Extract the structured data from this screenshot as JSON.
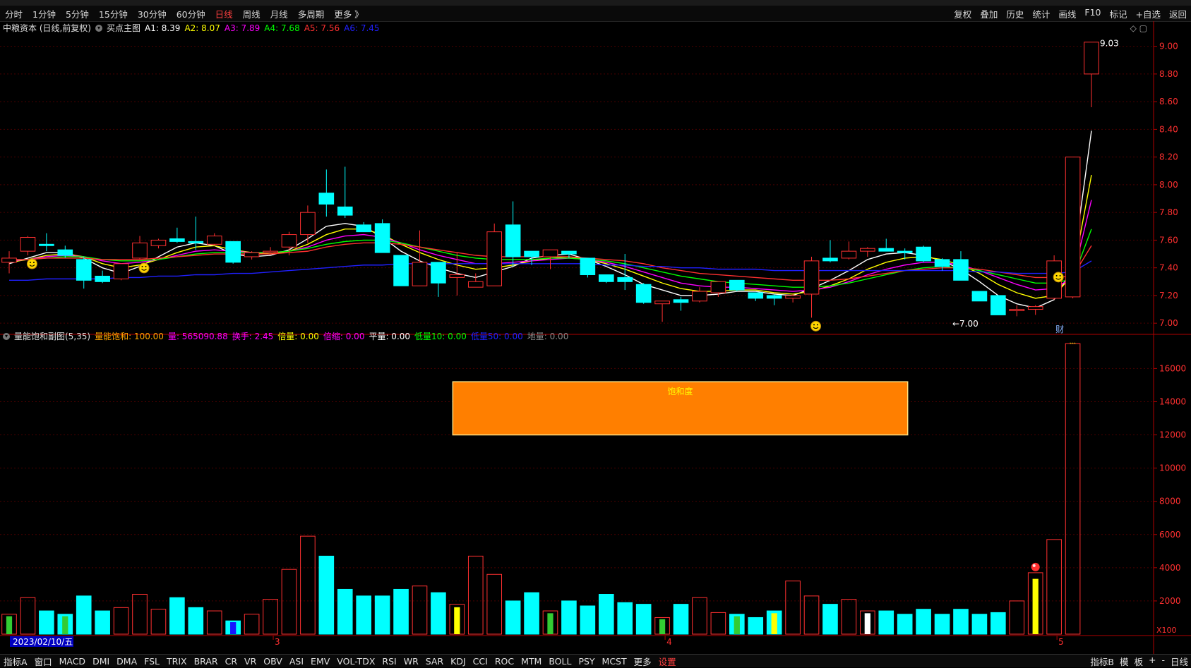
{
  "periods": [
    "分时",
    "1分钟",
    "5分钟",
    "15分钟",
    "30分钟",
    "60分钟",
    "日线",
    "周线",
    "月线",
    "多周期",
    "更多 》"
  ],
  "active_period": "日线",
  "toolbar_right": [
    "复权",
    "叠加",
    "历史",
    "统计",
    "画线",
    "F10",
    "标记",
    "+自选",
    "返回"
  ],
  "main_legend": {
    "title": "中粮资本 (日线,前复权)",
    "indicator": "买点主图",
    "items": [
      {
        "label": "A1: 8.39",
        "color": "#ffffff"
      },
      {
        "label": "A2: 8.07",
        "color": "#ffff00"
      },
      {
        "label": "A3: 7.89",
        "color": "#ff00ff"
      },
      {
        "label": "A4: 7.68",
        "color": "#00ff00"
      },
      {
        "label": "A5: 7.56",
        "color": "#ff3030"
      },
      {
        "label": "A6: 7.45",
        "color": "#2020ff"
      }
    ]
  },
  "sub_legend": {
    "title": "量能饱和副图(5,35)",
    "items": [
      {
        "label": "量能饱和: 100.00",
        "color": "#ffa500"
      },
      {
        "label": "量: 565090.88",
        "color": "#ff00ff"
      },
      {
        "label": "换手: 2.45",
        "color": "#ff00ff"
      },
      {
        "label": "倍量: 0.00",
        "color": "#ffff00"
      },
      {
        "label": "倍缩: 0.00",
        "color": "#ff00ff"
      },
      {
        "label": "平量: 0.00",
        "color": "#ffffff"
      },
      {
        "label": "低量10: 0.00",
        "color": "#00ff00"
      },
      {
        "label": "低量50: 0.00",
        "color": "#2020ff"
      },
      {
        "label": "地量: 0.00",
        "color": "#888888"
      }
    ]
  },
  "bottom_tabs": [
    "指标A",
    "窗口",
    "MACD",
    "DMI",
    "DMA",
    "FSL",
    "TRIX",
    "BRAR",
    "CR",
    "VR",
    "OBV",
    "ASI",
    "EMV",
    "VOL-TDX",
    "RSI",
    "WR",
    "SAR",
    "KDJ",
    "CCI",
    "ROC",
    "MTM",
    "BOLL",
    "PSY",
    "MCST",
    "更多",
    "设置"
  ],
  "bottom_right": [
    "指标B",
    "模",
    "板",
    "+",
    "-",
    "日线"
  ],
  "colors": {
    "up": "#ff3030",
    "down": "#00ffff",
    "axis": "#b00000",
    "bg": "#000000",
    "box": "#ff7f00"
  },
  "chart_data": [
    {
      "type": "candlestick",
      "ylim": [
        6.95,
        9.1
      ],
      "yticks": [
        "7.00",
        "7.20",
        "7.40",
        "7.60",
        "7.80",
        "8.00",
        "8.20",
        "8.40",
        "8.60",
        "8.80",
        "9.00"
      ],
      "annotations": {
        "high": "9.03",
        "low": "←7.00",
        "event": "财",
        "start_date": "2023/02/10/五",
        "month_marks": [
          "3",
          "4",
          "5"
        ]
      },
      "candles": [
        {
          "o": 7.44,
          "h": 7.52,
          "l": 7.36,
          "c": 7.47
        },
        {
          "o": 7.52,
          "h": 7.63,
          "l": 7.49,
          "c": 7.62
        },
        {
          "o": 7.57,
          "h": 7.65,
          "l": 7.52,
          "c": 7.56
        },
        {
          "o": 7.53,
          "h": 7.56,
          "l": 7.47,
          "c": 7.49
        },
        {
          "o": 7.46,
          "h": 7.48,
          "l": 7.25,
          "c": 7.31
        },
        {
          "o": 7.34,
          "h": 7.38,
          "l": 7.29,
          "c": 7.3
        },
        {
          "o": 7.32,
          "h": 7.43,
          "l": 7.31,
          "c": 7.43
        },
        {
          "o": 7.47,
          "h": 7.63,
          "l": 7.46,
          "c": 7.58
        },
        {
          "o": 7.56,
          "h": 7.61,
          "l": 7.54,
          "c": 7.6
        },
        {
          "o": 7.61,
          "h": 7.69,
          "l": 7.58,
          "c": 7.59
        },
        {
          "o": 7.59,
          "h": 7.77,
          "l": 7.53,
          "c": 7.58
        },
        {
          "o": 7.57,
          "h": 7.65,
          "l": 7.56,
          "c": 7.63
        },
        {
          "o": 7.59,
          "h": 7.59,
          "l": 7.43,
          "c": 7.44
        },
        {
          "o": 7.48,
          "h": 7.52,
          "l": 7.46,
          "c": 7.51
        },
        {
          "o": 7.51,
          "h": 7.55,
          "l": 7.5,
          "c": 7.52
        },
        {
          "o": 7.55,
          "h": 7.66,
          "l": 7.49,
          "c": 7.64
        },
        {
          "o": 7.64,
          "h": 7.85,
          "l": 7.58,
          "c": 7.8
        },
        {
          "o": 7.94,
          "h": 8.11,
          "l": 7.77,
          "c": 7.86
        },
        {
          "o": 7.84,
          "h": 8.13,
          "l": 7.76,
          "c": 7.78
        },
        {
          "o": 7.71,
          "h": 7.73,
          "l": 7.66,
          "c": 7.66
        },
        {
          "o": 7.72,
          "h": 7.75,
          "l": 7.51,
          "c": 7.51
        },
        {
          "o": 7.49,
          "h": 7.49,
          "l": 7.27,
          "c": 7.27
        },
        {
          "o": 7.27,
          "h": 7.67,
          "l": 7.27,
          "c": 7.44
        },
        {
          "o": 7.44,
          "h": 7.44,
          "l": 7.19,
          "c": 7.29
        },
        {
          "o": 7.33,
          "h": 7.51,
          "l": 7.2,
          "c": 7.35
        },
        {
          "o": 7.26,
          "h": 7.36,
          "l": 7.26,
          "c": 7.3
        },
        {
          "o": 7.27,
          "h": 7.72,
          "l": 7.27,
          "c": 7.66
        },
        {
          "o": 7.71,
          "h": 7.88,
          "l": 7.41,
          "c": 7.48
        },
        {
          "o": 7.52,
          "h": 7.52,
          "l": 7.42,
          "c": 7.48
        },
        {
          "o": 7.48,
          "h": 7.52,
          "l": 7.39,
          "c": 7.53
        },
        {
          "o": 7.52,
          "h": 7.52,
          "l": 7.47,
          "c": 7.5
        },
        {
          "o": 7.47,
          "h": 7.47,
          "l": 7.33,
          "c": 7.35
        },
        {
          "o": 7.35,
          "h": 7.35,
          "l": 7.29,
          "c": 7.3
        },
        {
          "o": 7.33,
          "h": 7.5,
          "l": 7.24,
          "c": 7.3
        },
        {
          "o": 7.28,
          "h": 7.29,
          "l": 7.14,
          "c": 7.15
        },
        {
          "o": 7.14,
          "h": 7.16,
          "l": 7.01,
          "c": 7.16
        },
        {
          "o": 7.17,
          "h": 7.19,
          "l": 7.09,
          "c": 7.15
        },
        {
          "o": 7.16,
          "h": 7.26,
          "l": 7.15,
          "c": 7.23
        },
        {
          "o": 7.22,
          "h": 7.3,
          "l": 7.19,
          "c": 7.3
        },
        {
          "o": 7.31,
          "h": 7.31,
          "l": 7.23,
          "c": 7.24
        },
        {
          "o": 7.22,
          "h": 7.22,
          "l": 7.16,
          "c": 7.18
        },
        {
          "o": 7.2,
          "h": 7.21,
          "l": 7.13,
          "c": 7.18
        },
        {
          "o": 7.18,
          "h": 7.21,
          "l": 7.15,
          "c": 7.2
        },
        {
          "o": 7.21,
          "h": 7.48,
          "l": 7.04,
          "c": 7.45
        },
        {
          "o": 7.47,
          "h": 7.6,
          "l": 7.44,
          "c": 7.45
        },
        {
          "o": 7.47,
          "h": 7.59,
          "l": 7.46,
          "c": 7.52
        },
        {
          "o": 7.52,
          "h": 7.55,
          "l": 7.48,
          "c": 7.54
        },
        {
          "o": 7.54,
          "h": 7.61,
          "l": 7.52,
          "c": 7.52
        },
        {
          "o": 7.52,
          "h": 7.54,
          "l": 7.46,
          "c": 7.51
        },
        {
          "o": 7.55,
          "h": 7.56,
          "l": 7.44,
          "c": 7.45
        },
        {
          "o": 7.46,
          "h": 7.47,
          "l": 7.38,
          "c": 7.41
        },
        {
          "o": 7.46,
          "h": 7.52,
          "l": 7.32,
          "c": 7.31
        },
        {
          "o": 7.23,
          "h": 7.23,
          "l": 7.16,
          "c": 7.16
        },
        {
          "o": 7.2,
          "h": 7.2,
          "l": 7.08,
          "c": 7.06
        },
        {
          "o": 7.09,
          "h": 7.13,
          "l": 7.05,
          "c": 7.1
        },
        {
          "o": 7.1,
          "h": 7.13,
          "l": 7.06,
          "c": 7.12
        },
        {
          "o": 7.18,
          "h": 7.49,
          "l": 7.17,
          "c": 7.45
        },
        {
          "o": 7.19,
          "h": 8.2,
          "l": 7.18,
          "c": 8.2
        },
        {
          "o": 8.8,
          "h": 9.03,
          "l": 8.56,
          "c": 9.03
        }
      ],
      "ma_lines": [
        {
          "name": "A1",
          "color": "#ffffff",
          "values": [
            7.43,
            7.47,
            7.51,
            7.51,
            7.47,
            7.4,
            7.36,
            7.41,
            7.48,
            7.55,
            7.58,
            7.56,
            7.5,
            7.48,
            7.49,
            7.53,
            7.61,
            7.7,
            7.72,
            7.7,
            7.62,
            7.52,
            7.45,
            7.4,
            7.36,
            7.33,
            7.37,
            7.41,
            7.47,
            7.49,
            7.5,
            7.46,
            7.41,
            7.35,
            7.28,
            7.24,
            7.2,
            7.2,
            7.21,
            7.23,
            7.23,
            7.21,
            7.2,
            7.25,
            7.31,
            7.38,
            7.46,
            7.5,
            7.51,
            7.49,
            7.45,
            7.39,
            7.3,
            7.2,
            7.14,
            7.11,
            7.17,
            7.4,
            8.39
          ]
        },
        {
          "name": "A2",
          "color": "#ffff00",
          "values": [
            7.44,
            7.46,
            7.49,
            7.5,
            7.48,
            7.43,
            7.4,
            7.42,
            7.46,
            7.51,
            7.55,
            7.56,
            7.53,
            7.51,
            7.5,
            7.52,
            7.57,
            7.64,
            7.68,
            7.68,
            7.64,
            7.57,
            7.51,
            7.46,
            7.42,
            7.39,
            7.4,
            7.42,
            7.45,
            7.47,
            7.48,
            7.46,
            7.43,
            7.39,
            7.34,
            7.29,
            7.25,
            7.23,
            7.23,
            7.24,
            7.24,
            7.22,
            7.21,
            7.23,
            7.27,
            7.32,
            7.39,
            7.44,
            7.47,
            7.48,
            7.46,
            7.42,
            7.36,
            7.28,
            7.22,
            7.18,
            7.2,
            7.35,
            8.07
          ]
        },
        {
          "name": "A3",
          "color": "#ff00ff",
          "values": [
            7.45,
            7.46,
            7.48,
            7.49,
            7.48,
            7.45,
            7.43,
            7.44,
            7.46,
            7.49,
            7.52,
            7.53,
            7.52,
            7.51,
            7.51,
            7.52,
            7.55,
            7.6,
            7.63,
            7.64,
            7.62,
            7.58,
            7.53,
            7.49,
            7.46,
            7.43,
            7.43,
            7.44,
            7.45,
            7.46,
            7.47,
            7.46,
            7.44,
            7.41,
            7.37,
            7.33,
            7.29,
            7.27,
            7.26,
            7.26,
            7.25,
            7.24,
            7.23,
            7.24,
            7.26,
            7.3,
            7.35,
            7.39,
            7.42,
            7.44,
            7.44,
            7.42,
            7.38,
            7.33,
            7.28,
            7.24,
            7.25,
            7.33,
            7.89
          ]
        },
        {
          "name": "A4",
          "color": "#00ff00",
          "values": [
            7.46,
            7.46,
            7.47,
            7.48,
            7.48,
            7.46,
            7.45,
            7.45,
            7.46,
            7.48,
            7.5,
            7.51,
            7.51,
            7.51,
            7.51,
            7.52,
            7.54,
            7.57,
            7.59,
            7.6,
            7.6,
            7.58,
            7.55,
            7.52,
            7.49,
            7.47,
            7.46,
            7.46,
            7.46,
            7.47,
            7.47,
            7.46,
            7.45,
            7.43,
            7.4,
            7.37,
            7.34,
            7.32,
            7.3,
            7.29,
            7.28,
            7.27,
            7.26,
            7.26,
            7.27,
            7.29,
            7.32,
            7.35,
            7.38,
            7.4,
            7.41,
            7.4,
            7.38,
            7.35,
            7.32,
            7.29,
            7.29,
            7.32,
            7.68
          ]
        },
        {
          "name": "A5",
          "color": "#ff3030",
          "values": [
            7.46,
            7.46,
            7.47,
            7.47,
            7.47,
            7.46,
            7.46,
            7.46,
            7.47,
            7.48,
            7.49,
            7.5,
            7.5,
            7.5,
            7.5,
            7.51,
            7.52,
            7.55,
            7.57,
            7.58,
            7.58,
            7.57,
            7.55,
            7.53,
            7.51,
            7.49,
            7.48,
            7.48,
            7.48,
            7.48,
            7.48,
            7.47,
            7.46,
            7.45,
            7.43,
            7.4,
            7.38,
            7.36,
            7.35,
            7.34,
            7.33,
            7.32,
            7.31,
            7.31,
            7.31,
            7.32,
            7.34,
            7.36,
            7.38,
            7.39,
            7.4,
            7.4,
            7.39,
            7.37,
            7.35,
            7.33,
            7.33,
            7.34,
            7.56
          ]
        },
        {
          "name": "A6",
          "color": "#2020ff",
          "values": [
            7.31,
            7.31,
            7.32,
            7.32,
            7.32,
            7.32,
            7.33,
            7.33,
            7.34,
            7.34,
            7.35,
            7.35,
            7.36,
            7.36,
            7.37,
            7.38,
            7.39,
            7.4,
            7.41,
            7.42,
            7.42,
            7.43,
            7.43,
            7.43,
            7.43,
            7.43,
            7.43,
            7.43,
            7.43,
            7.43,
            7.43,
            7.43,
            7.42,
            7.42,
            7.41,
            7.41,
            7.4,
            7.4,
            7.39,
            7.39,
            7.39,
            7.38,
            7.38,
            7.38,
            7.38,
            7.38,
            7.38,
            7.38,
            7.38,
            7.38,
            7.38,
            7.38,
            7.37,
            7.37,
            7.36,
            7.36,
            7.36,
            7.37,
            7.45
          ]
        }
      ],
      "smiley_markers": [
        1,
        7,
        43,
        56
      ]
    },
    {
      "type": "bar",
      "ylim": [
        0,
        17800
      ],
      "yticks": [
        "2000",
        "4000",
        "6000",
        "8000",
        "10000",
        "12000",
        "14000",
        "16000"
      ],
      "unit": "X100",
      "saturation_box": {
        "label": "饱和度",
        "from_index": 24,
        "to_index": 48,
        "y_top": 15200,
        "y_bottom": 12000
      },
      "volumes": [
        1200,
        2200,
        1400,
        1200,
        2300,
        1400,
        1600,
        2400,
        1500,
        2200,
        1600,
        1400,
        800,
        1200,
        2100,
        3900,
        5900,
        4700,
        2700,
        2300,
        2300,
        2700,
        2900,
        2500,
        1800,
        4700,
        3600,
        2000,
        2500,
        1400,
        2000,
        1700,
        2400,
        1900,
        1800,
        1000,
        1800,
        2200,
        1300,
        1200,
        1000,
        1400,
        3200,
        2300,
        1800,
        2100,
        1400,
        1400,
        1200,
        1500,
        1200,
        1500,
        1200,
        1300,
        2000,
        3700,
        5700,
        17500
      ],
      "markers": {
        "yellow": [
          24,
          41,
          55
        ],
        "green": [
          0,
          3,
          29,
          35,
          39
        ],
        "blue": [
          12
        ],
        "white": [
          46
        ],
        "red_ball": 55
      }
    }
  ]
}
